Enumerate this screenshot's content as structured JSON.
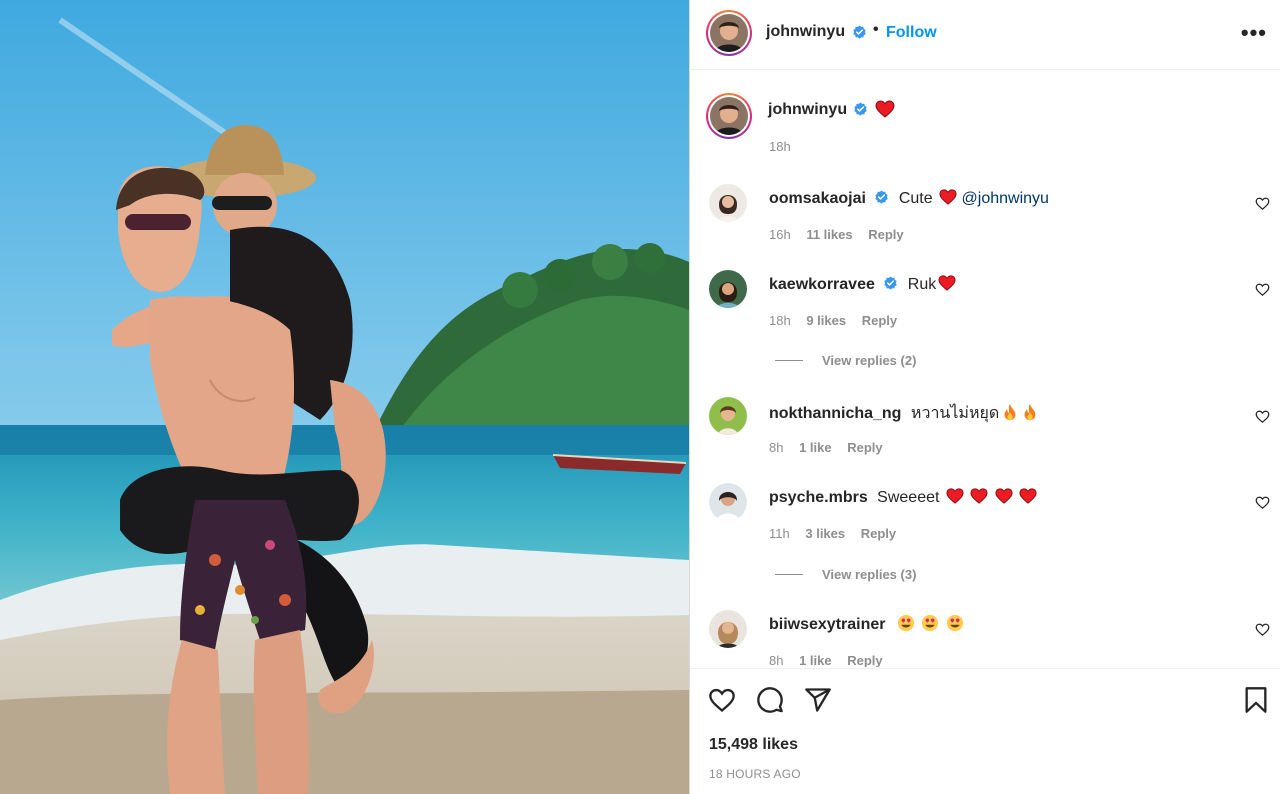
{
  "post": {
    "author": {
      "username": "johnwinyu",
      "verified": true,
      "follow_label": "Follow",
      "separator": "•",
      "more_label": "•••"
    },
    "caption": {
      "username": "johnwinyu",
      "emoji": "red-heart",
      "time": "18h"
    },
    "comments": [
      {
        "username": "oomsakaojai",
        "verified": true,
        "text": "Cute",
        "emoji_after_text": [
          "red-heart"
        ],
        "mention": "@johnwinyu",
        "time": "16h",
        "likes": "11 likes",
        "reply": "Reply"
      },
      {
        "username": "kaewkorravee",
        "verified": true,
        "text": "Ruk",
        "emoji_after_text": [
          "red-heart"
        ],
        "time": "18h",
        "likes": "9 likes",
        "reply": "Reply",
        "view_replies": "View replies (2)"
      },
      {
        "username": "nokthannicha_ng",
        "verified": false,
        "text": "หวานไม่หยุด",
        "emoji_after_text": [
          "fire",
          "fire"
        ],
        "time": "8h",
        "likes": "1 like",
        "reply": "Reply"
      },
      {
        "username": "psyche.mbrs",
        "verified": false,
        "text": "Sweeeet",
        "emoji_after_text": [
          "red-heart",
          "red-heart",
          "red-heart",
          "red-heart"
        ],
        "time": "11h",
        "likes": "3 likes",
        "reply": "Reply",
        "view_replies": "View replies (3)"
      },
      {
        "username": "biiwsexytrainer",
        "verified": false,
        "text": "",
        "emoji_after_text": [
          "heart-eyes",
          "heart-eyes",
          "heart-eyes"
        ],
        "time": "8h",
        "likes": "1 like",
        "reply": "Reply"
      }
    ],
    "likes_total": "15,498 likes",
    "posted": "18 HOURS AGO",
    "icons": [
      "heart-icon",
      "comment-icon",
      "share-icon",
      "bookmark-icon"
    ],
    "colors": {
      "accent": "#0095f6",
      "text": "#262626",
      "muted": "#8e8e8e",
      "heart": "#ed1c24"
    }
  }
}
